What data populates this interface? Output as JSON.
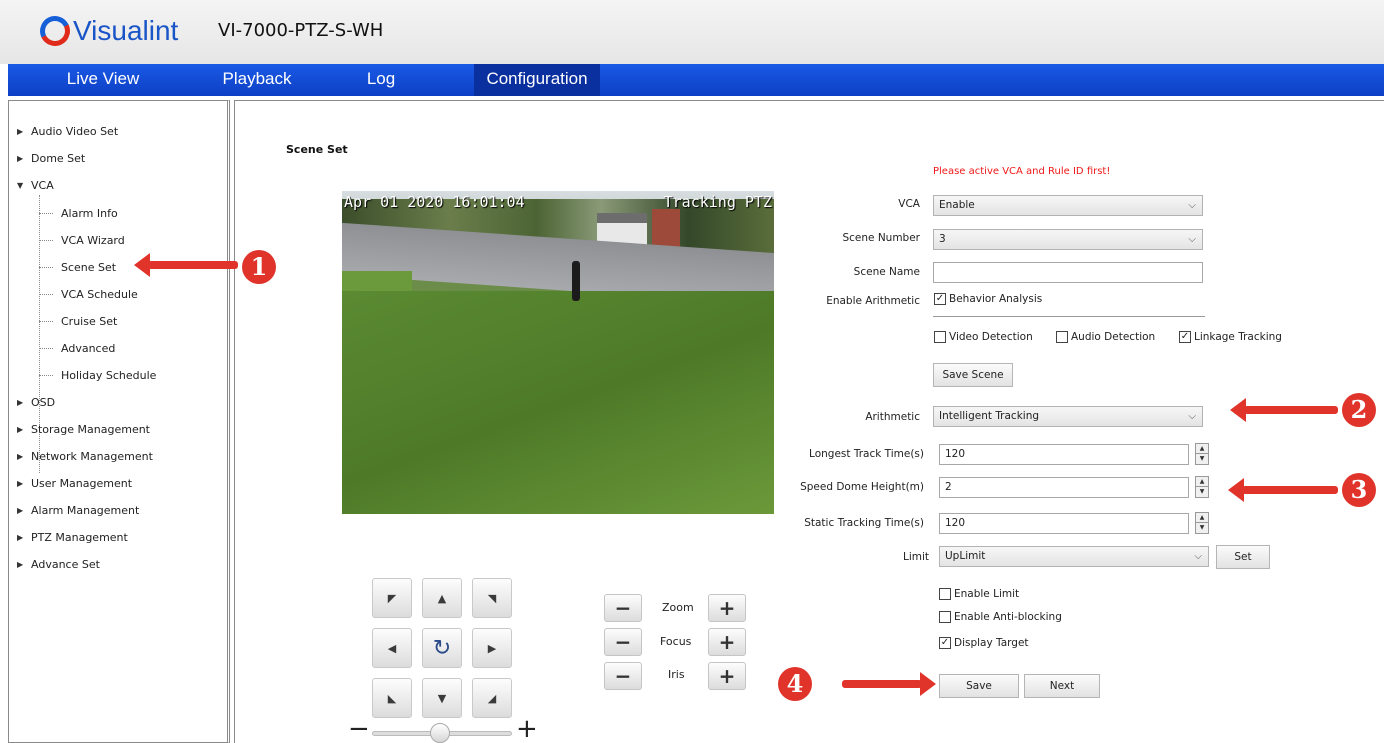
{
  "header": {
    "brand": "Visualint",
    "model": "VI-7000-PTZ-S-WH"
  },
  "nav": {
    "items": [
      "Live View",
      "Playback",
      "Log",
      "Configuration"
    ],
    "active": "Configuration"
  },
  "sidebar": {
    "top": [
      "Audio Video Set",
      "Dome Set",
      "VCA"
    ],
    "vca_children": [
      "Alarm Info",
      "VCA Wizard",
      "Scene Set",
      "VCA Schedule",
      "Cruise Set",
      "Advanced",
      "Holiday Schedule"
    ],
    "bottom": [
      "OSD",
      "Storage Management",
      "Network Management",
      "User Management",
      "Alarm Management",
      "PTZ Management",
      "Advance Set"
    ]
  },
  "main": {
    "title": "Scene Set",
    "video": {
      "timestamp": "Apr 01 2020 16:01:04",
      "mode": "Tracking PTZ"
    },
    "lens": {
      "zoom": "Zoom",
      "focus": "Focus",
      "iris": "Iris"
    },
    "warning": "Please active VCA and Rule ID first!",
    "form": {
      "vca_label": "VCA",
      "vca_value": "Enable",
      "scene_number_label": "Scene Number",
      "scene_number_value": "3",
      "scene_name_label": "Scene Name",
      "scene_name_value": "",
      "enable_arithmetic_label": "Enable Arithmetic",
      "behavior_analysis": "Behavior Analysis",
      "video_detection": "Video Detection",
      "audio_detection": "Audio Detection",
      "linkage_tracking": "Linkage Tracking",
      "save_scene": "Save Scene",
      "arithmetic_label": "Arithmetic",
      "arithmetic_value": "Intelligent Tracking",
      "longest_track_label": "Longest Track Time(s)",
      "longest_track_value": "120",
      "dome_height_label": "Speed Dome Height(m)",
      "dome_height_value": "2",
      "static_tracking_label": "Static Tracking Time(s)",
      "static_tracking_value": "120",
      "limit_label": "Limit",
      "limit_value": "UpLimit",
      "set": "Set",
      "enable_limit": "Enable Limit",
      "enable_anti_blocking": "Enable Anti-blocking",
      "display_target": "Display Target",
      "save": "Save",
      "next": "Next"
    }
  },
  "annotations": [
    "1",
    "2",
    "3",
    "4"
  ],
  "colors": {
    "nav_blue": "#1a5ae6",
    "warning_red": "#f01818",
    "annotation_red": "#e0332a"
  }
}
